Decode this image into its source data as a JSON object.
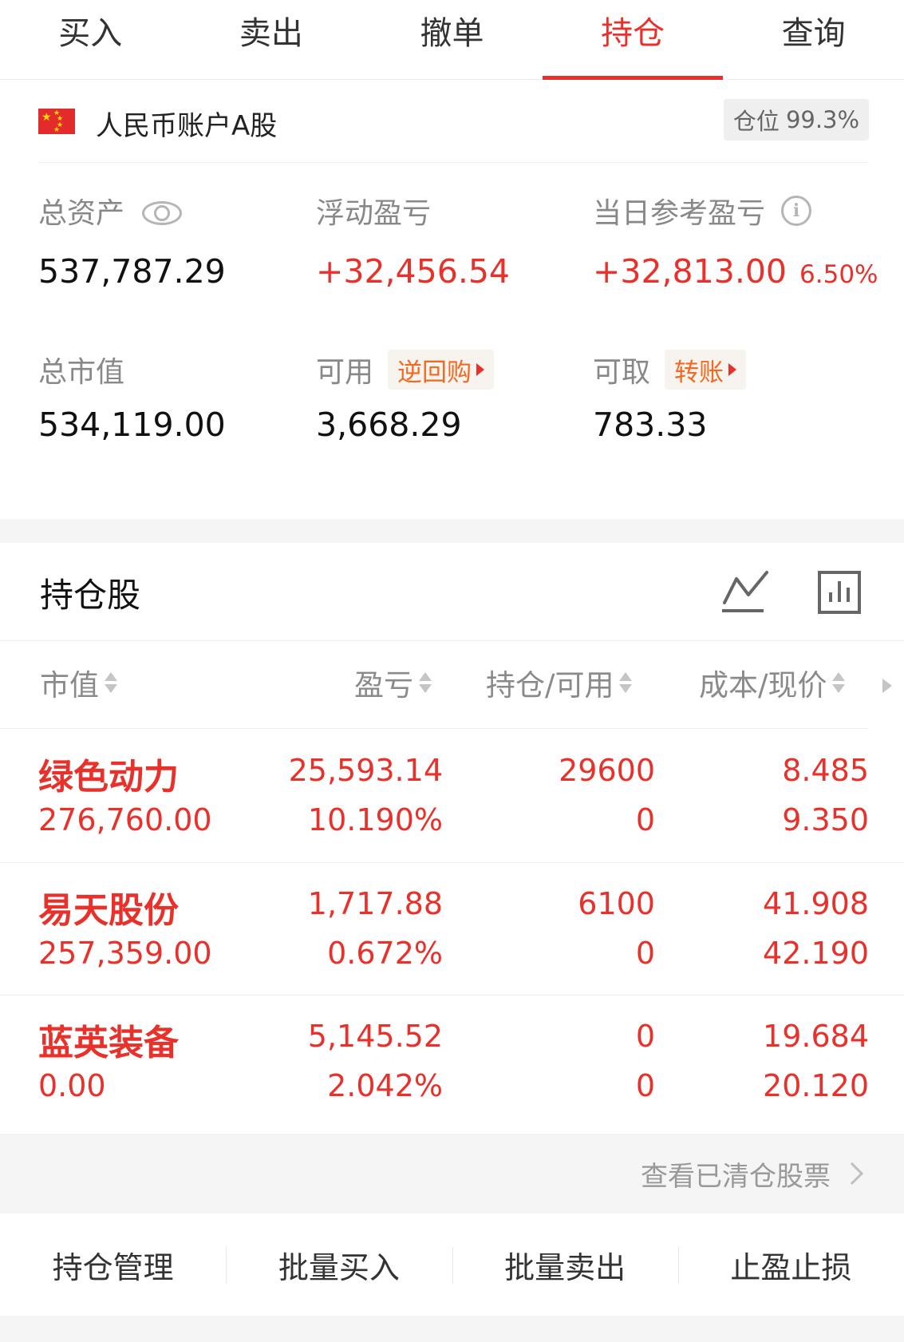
{
  "tabs": [
    {
      "label": "买入",
      "active": false
    },
    {
      "label": "卖出",
      "active": false
    },
    {
      "label": "撤单",
      "active": false
    },
    {
      "label": "持仓",
      "active": true
    },
    {
      "label": "查询",
      "active": false
    }
  ],
  "account": {
    "name": "人民币账户A股",
    "flag_icon": "china-flag-icon",
    "position_label": "仓位",
    "position_value": "99.3%"
  },
  "metrics": {
    "total_assets": {
      "label": "总资产",
      "value": "537,787.29"
    },
    "floating_pl": {
      "label": "浮动盈亏",
      "value": "+32,456.54"
    },
    "daily_pl": {
      "label": "当日参考盈亏",
      "value": "+32,813.00",
      "pct": "6.50%"
    },
    "market_value": {
      "label": "总市值",
      "value": "534,119.00"
    },
    "available": {
      "label": "可用",
      "link": "逆回购",
      "value": "3,668.29"
    },
    "withdrawable": {
      "label": "可取",
      "link": "转账",
      "value": "783.33"
    }
  },
  "holdings": {
    "title": "持仓股",
    "columns": [
      "市值",
      "盈亏",
      "持仓/可用",
      "成本/现价"
    ],
    "rows": [
      {
        "name": "绿色动力",
        "market_value": "276,760.00",
        "pl": "25,593.14",
        "pl_pct": "10.190%",
        "position": "29600",
        "available": "0",
        "cost": "8.485",
        "price": "9.350"
      },
      {
        "name": "易天股份",
        "market_value": "257,359.00",
        "pl": "1,717.88",
        "pl_pct": "0.672%",
        "position": "6100",
        "available": "0",
        "cost": "41.908",
        "price": "42.190"
      },
      {
        "name": "蓝英装备",
        "market_value": "0.00",
        "pl": "5,145.52",
        "pl_pct": "2.042%",
        "position": "0",
        "available": "0",
        "cost": "19.684",
        "price": "20.120"
      }
    ],
    "cleared_link": "查看已清仓股票"
  },
  "footer": [
    "持仓管理",
    "批量买入",
    "批量卖出",
    "止盈止损"
  ],
  "colors": {
    "accent": "#e8312a",
    "link_orange": "#ef6a22",
    "muted": "#888888"
  }
}
